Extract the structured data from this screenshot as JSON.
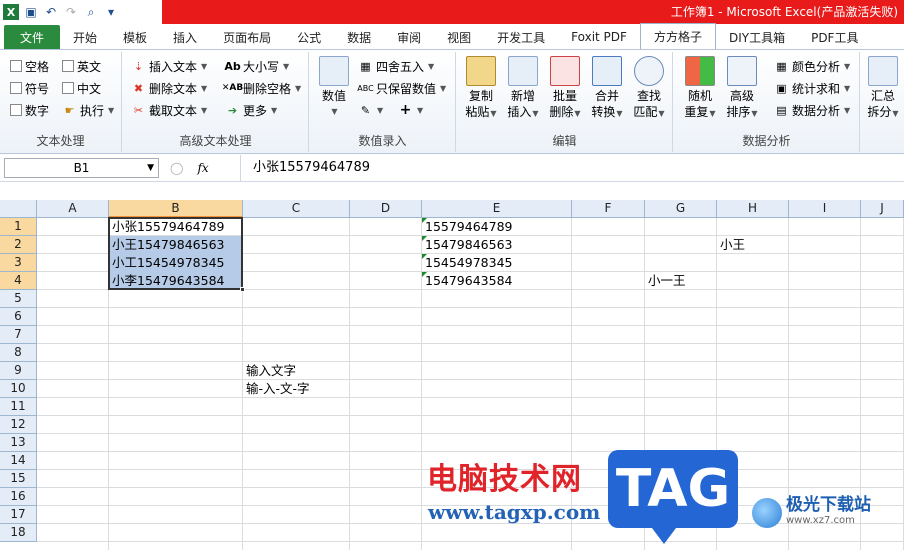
{
  "title": "工作簿1 - Microsoft Excel(产品激活失败)",
  "tabs": [
    "文件",
    "开始",
    "模板",
    "插入",
    "页面布局",
    "公式",
    "数据",
    "审阅",
    "视图",
    "开发工具",
    "Foxit PDF",
    "方方格子",
    "DIY工具箱",
    "PDF工具"
  ],
  "active_tab": "方方格子",
  "ribbon": {
    "text_group": {
      "label": "文本处理",
      "items": [
        "空格",
        "英文",
        "符号",
        "中文",
        "数字",
        "执行"
      ]
    },
    "adv_group": {
      "label": "高级文本处理",
      "items": [
        "插入文本",
        "大小写",
        "删除文本",
        "删除空格",
        "截取文本",
        "更多"
      ]
    },
    "num_group": {
      "label": "数值录入",
      "big": "数值",
      "items": [
        "四舍五入",
        "只保留数值"
      ]
    },
    "edit_group": {
      "label": "编辑",
      "buttons": [
        {
          "l1": "复制",
          "l2": "粘贴"
        },
        {
          "l1": "新增",
          "l2": "插入"
        },
        {
          "l1": "批量",
          "l2": "删除"
        },
        {
          "l1": "合并",
          "l2": "转换"
        },
        {
          "l1": "查找",
          "l2": "匹配"
        }
      ]
    },
    "analysis_group": {
      "label": "数据分析",
      "buttons": [
        {
          "l1": "随机",
          "l2": "重复"
        },
        {
          "l1": "高级",
          "l2": "排序"
        }
      ],
      "items": [
        "颜色分析",
        "统计求和",
        "数据分析"
      ]
    },
    "summary": {
      "l1": "汇总",
      "l2": "拆分"
    }
  },
  "formula_bar": {
    "name_box": "B1",
    "fx": "fx",
    "formula": "小张15579464789"
  },
  "columns": [
    "A",
    "B",
    "C",
    "D",
    "E",
    "F",
    "G",
    "H",
    "I",
    "J"
  ],
  "rows": [
    "1",
    "2",
    "3",
    "4",
    "5",
    "6",
    "7",
    "8",
    "9",
    "10",
    "11",
    "12",
    "13",
    "14",
    "15",
    "16",
    "17",
    "18"
  ],
  "cells": {
    "B1": "小张15579464789",
    "B2": "小王15479846563",
    "B3": "小工15454978345",
    "B4": "小李15479643584",
    "E1": "15579464789",
    "E2": "15479846563",
    "E3": "15454978345",
    "E4": "15479643584",
    "H2": "小王",
    "G4": "小一王",
    "C9": "输入文字",
    "C10": "输-入-文-字"
  },
  "watermark": {
    "text": "电脑技术网",
    "url": "www.tagxp.com",
    "tag": "TAG",
    "logo": "极光下载站",
    "logo_url": "www.xz7.com"
  },
  "colors": {
    "file_tab": "#2a8a3e",
    "title_bar": "#e81a1a",
    "selection": "#b6cbe7",
    "header_selected": "#f9d99f"
  }
}
